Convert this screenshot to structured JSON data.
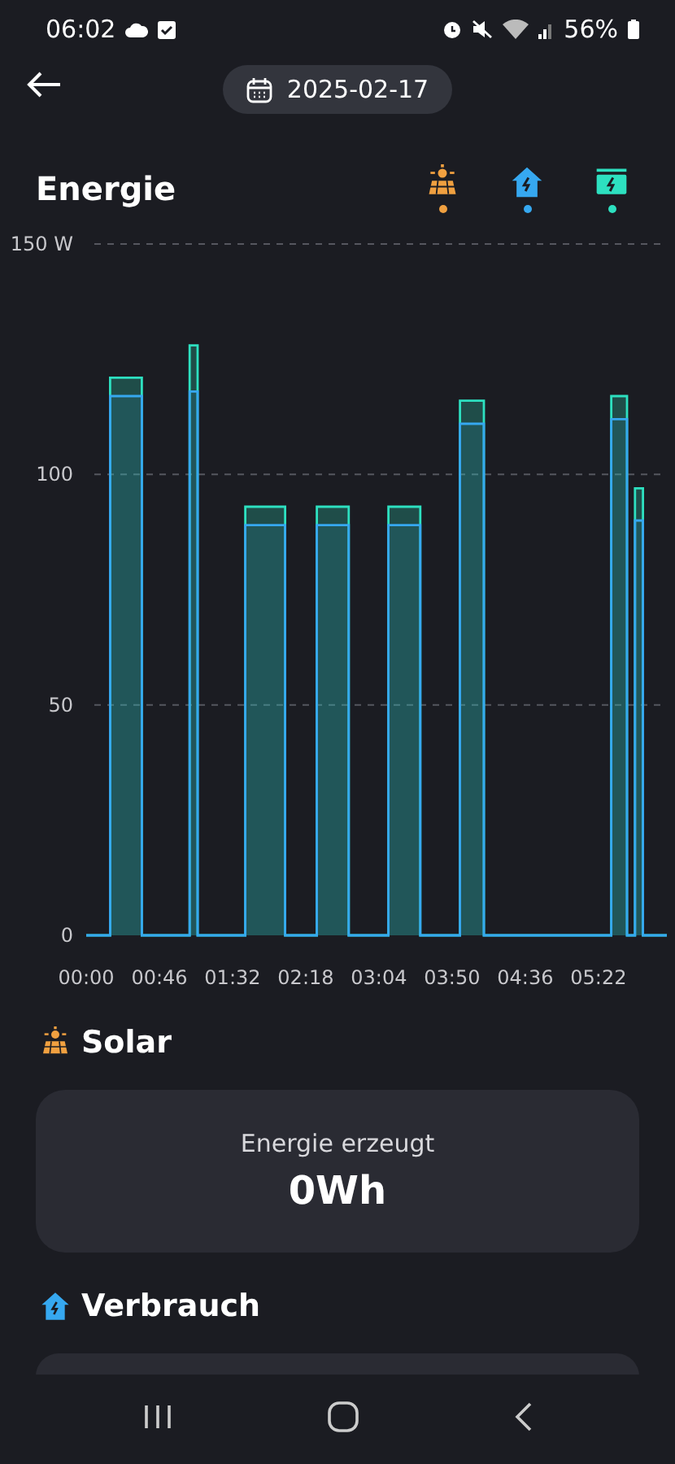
{
  "status_bar": {
    "time": "06:02",
    "battery": "56%"
  },
  "header": {
    "date": "2025-02-17"
  },
  "title": "Energie",
  "legend": [
    {
      "kind": "solar",
      "color": "#f0a040"
    },
    {
      "kind": "home",
      "color": "#36a8f0"
    },
    {
      "kind": "battery",
      "color": "#2de0c0"
    }
  ],
  "chart_data": {
    "type": "area",
    "ylim": [
      0,
      150
    ],
    "yticks": [
      0,
      {
        "value": 50,
        "label": "50"
      },
      {
        "value": 100,
        "label": "100"
      },
      {
        "value": 150,
        "label": "150 W"
      }
    ],
    "xlim": [
      0,
      365
    ],
    "xticks": [
      {
        "value": 0,
        "label": "00:00"
      },
      {
        "value": 46,
        "label": "00:46"
      },
      {
        "value": 92,
        "label": "01:32"
      },
      {
        "value": 138,
        "label": "02:18"
      },
      {
        "value": 184,
        "label": "03:04"
      },
      {
        "value": 230,
        "label": "03:50"
      },
      {
        "value": 276,
        "label": "04:36"
      },
      {
        "value": 322,
        "label": "05:22"
      }
    ],
    "x": [
      0,
      5,
      10,
      15,
      20,
      25,
      30,
      35,
      40,
      45,
      50,
      55,
      60,
      65,
      70,
      75,
      80,
      85,
      90,
      95,
      100,
      105,
      110,
      115,
      120,
      125,
      130,
      135,
      140,
      145,
      150,
      155,
      160,
      165,
      170,
      175,
      180,
      185,
      190,
      195,
      200,
      205,
      210,
      215,
      220,
      225,
      230,
      235,
      240,
      245,
      250,
      255,
      260,
      265,
      270,
      275,
      280,
      285,
      290,
      295,
      300,
      305,
      310,
      315,
      320,
      325,
      330,
      335,
      340,
      345,
      350,
      355,
      360,
      365
    ],
    "series": [
      {
        "color": "#2de0c0",
        "values": [
          0,
          0,
          0,
          121,
          121,
          121,
          121,
          0,
          0,
          0,
          0,
          0,
          0,
          128,
          0,
          0,
          0,
          0,
          0,
          0,
          93,
          93,
          93,
          93,
          93,
          0,
          0,
          0,
          0,
          93,
          93,
          93,
          93,
          0,
          0,
          0,
          0,
          0,
          93,
          93,
          93,
          93,
          0,
          0,
          0,
          0,
          0,
          116,
          116,
          116,
          0,
          0,
          0,
          0,
          0,
          0,
          0,
          0,
          0,
          0,
          0,
          0,
          0,
          0,
          0,
          0,
          117,
          117,
          0,
          97,
          0,
          0,
          0,
          0
        ]
      },
      {
        "color": "#36a8f0",
        "values": [
          0,
          0,
          0,
          117,
          117,
          117,
          117,
          0,
          0,
          0,
          0,
          0,
          0,
          118,
          0,
          0,
          0,
          0,
          0,
          0,
          89,
          89,
          89,
          89,
          89,
          0,
          0,
          0,
          0,
          89,
          89,
          89,
          89,
          0,
          0,
          0,
          0,
          0,
          89,
          89,
          89,
          89,
          0,
          0,
          0,
          0,
          0,
          111,
          111,
          111,
          0,
          0,
          0,
          0,
          0,
          0,
          0,
          0,
          0,
          0,
          0,
          0,
          0,
          0,
          0,
          0,
          112,
          112,
          0,
          90,
          0,
          0,
          0,
          0
        ]
      }
    ]
  },
  "sections": [
    {
      "kind": "solar",
      "heading": "Solar",
      "card_label": "Energie erzeugt",
      "card_value": "0Wh"
    },
    {
      "kind": "home",
      "heading": "Verbrauch"
    }
  ]
}
